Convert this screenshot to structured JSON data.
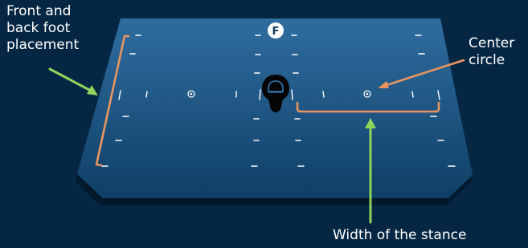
{
  "annotations": {
    "foot_placement": "Front and\nback foot\nplacement",
    "center_circle": "Center\ncircle",
    "stance_width": "Width of the stance"
  },
  "board": {
    "front_marker": "F"
  },
  "colors": {
    "background": "#062743",
    "board_light": "#2f6da0",
    "board_dark": "#0f3f66",
    "edge": "#031a2e",
    "bracket_orange": "#e8955f",
    "arrow_green": "#8fd45a",
    "marker_white": "#ffffff"
  }
}
